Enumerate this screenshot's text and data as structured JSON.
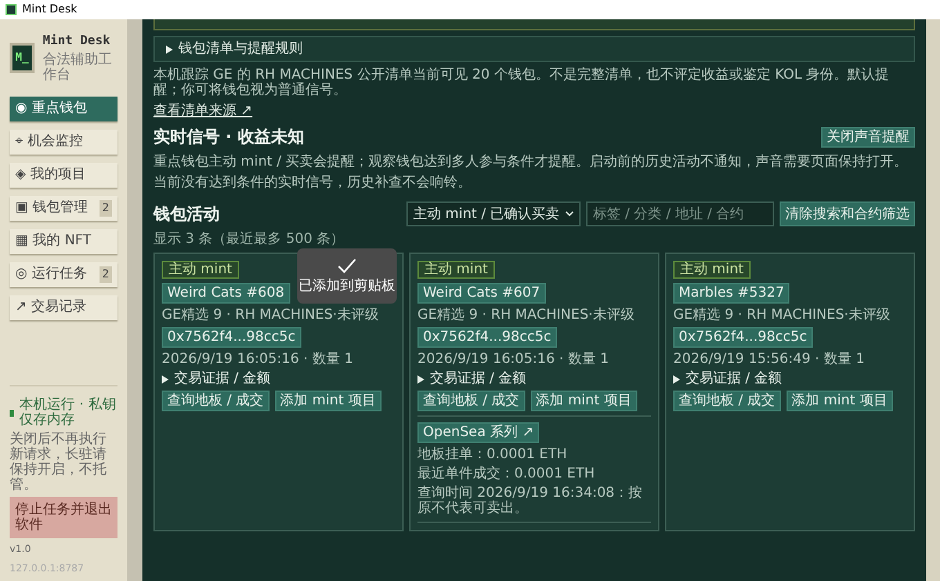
{
  "window": {
    "title": "Mint Desk"
  },
  "brand": {
    "logo": "M_",
    "name": "Mint Desk",
    "subtitle": "合法辅助工作台"
  },
  "nav": [
    {
      "icon": "◉",
      "label": "重点钱包",
      "selected": true
    },
    {
      "icon": "⌖",
      "label": "机会监控",
      "selected": false
    },
    {
      "icon": "◈",
      "label": "我的项目",
      "selected": false
    },
    {
      "icon": "▣",
      "label": "钱包管理",
      "badge": "2",
      "selected": false
    },
    {
      "icon": "▦",
      "label": "我的 NFT",
      "selected": false
    },
    {
      "icon": "◎",
      "label": "运行任务",
      "badge": "2",
      "selected": false
    },
    {
      "icon": "↗",
      "label": "交易记录",
      "selected": false
    }
  ],
  "sidebar_footer": {
    "status": "本机运行 · 私钥仅存内存",
    "note": "关闭后不再执行新请求，长驻请保持开启，不托管。",
    "stop_button": "停止任务并退出软件",
    "version": "v1.0",
    "address": "127.0.0.1:8787"
  },
  "rules": {
    "summary": "钱包清单与提醒规则",
    "expanded": false
  },
  "intro": "本机跟踪 GE 的 RH MACHINES 公开清单当前可见 20 个钱包。不是完整清单，也不评定收益或鉴定 KOL 身份。默认提醒；你可将钱包视为普通信号。",
  "source_link": "查看清单来源 ↗",
  "signals": {
    "title": "实时信号 · 收益未知",
    "sound_button": "关闭声音提醒",
    "description": "重点钱包主动 mint / 买卖会提醒；观察钱包达到多人参与条件才提醒。启动前的历史活动不通知，声音需要页面保持打开。",
    "empty": "当前没有达到条件的实时信号，历史补查不会响铃。"
  },
  "activity": {
    "title": "钱包活动",
    "filter": "主动 mint / 已确认买卖",
    "search": {
      "placeholder": "标签 / 分类 / 地址 / 合约"
    },
    "clear_button": "清除搜索和合约筛选",
    "count": "显示 3 条（最近最多 500 条）",
    "cards": [
      {
        "tag": "主动 mint",
        "name": "Weird Cats #608",
        "source": "GE精选 9 · RH MACHINES·未评级",
        "address": "0x7562f4...98cc5c",
        "time": "2026/9/19 16:05:16 · 数量 1",
        "evidence": "交易证据 / 金额",
        "floor_button": "查询地板 / 成交",
        "add_button": "添加 mint 项目"
      },
      {
        "tag": "主动 mint",
        "name": "Weird Cats #607",
        "source": "GE精选 9 · RH MACHINES·未评级",
        "address": "0x7562f4...98cc5c",
        "time": "2026/9/19 16:05:16 · 数量 1",
        "evidence": "交易证据 / 金额",
        "floor_button": "查询地板 / 成交",
        "add_button": "添加 mint 项目",
        "market": {
          "link": "OpenSea 系列 ↗",
          "floor": "地板挂单：0.0001 ETH",
          "last_sale": "最近单件成交：0.0001 ETH",
          "queried": "查询时间 2026/9/19 16:34:08：按原不代表可卖出。"
        }
      },
      {
        "tag": "主动 mint",
        "name": "Marbles #5327",
        "source": "GE精选 9 · RH MACHINES·未评级",
        "address": "0x7562f4...98cc5c",
        "time": "2026/9/19 15:56:49 · 数量 1",
        "evidence": "交易证据 / 金额",
        "floor_button": "查询地板 / 成交",
        "add_button": "添加 mint 项目"
      }
    ]
  },
  "toast": {
    "message": "已添加到剪贴板"
  }
}
